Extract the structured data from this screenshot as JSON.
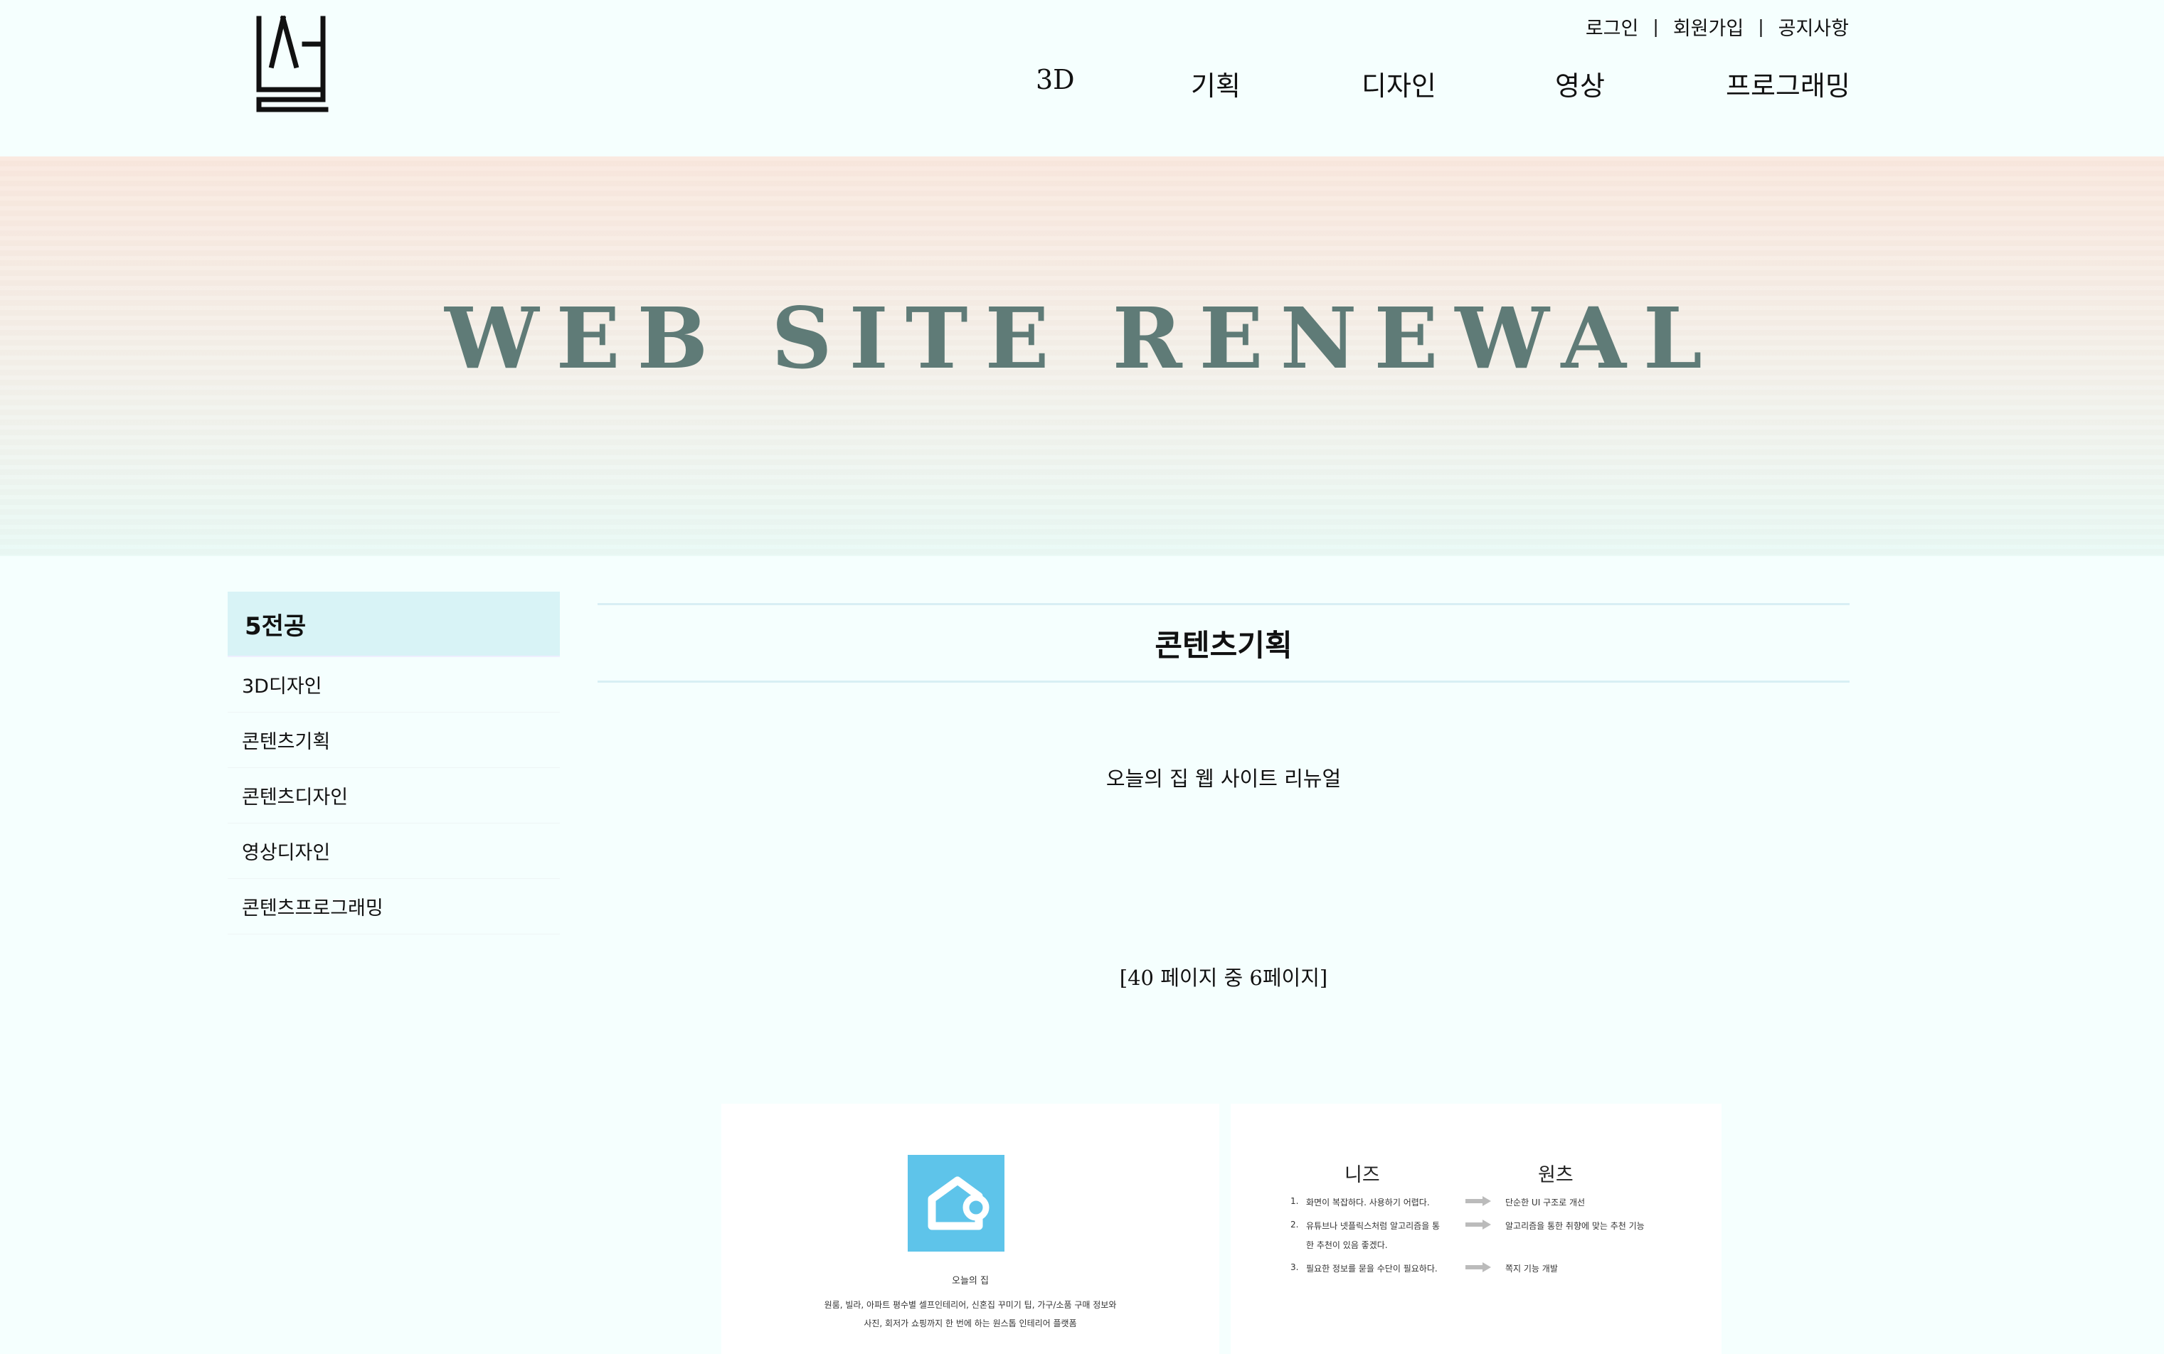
{
  "header": {
    "util_links": [
      "로그인",
      "회원가입",
      "공지사항"
    ],
    "util_separator": "|",
    "nav": [
      "3D",
      "기획",
      "디자인",
      "영상",
      "프로그래밍"
    ]
  },
  "banner": {
    "title": "WEB SITE RENEWAL"
  },
  "sidebar": {
    "heading": "5전공",
    "items": [
      "3D디자인",
      "콘텐츠기획",
      "콘텐츠디자인",
      "영상디자인",
      "콘텐츠프로그래밍"
    ]
  },
  "main": {
    "title": "콘텐츠기획",
    "subtitle": "오늘의 집 웹 사이트 리뉴얼",
    "page_info": "[40 페이지 중 6페이지]"
  },
  "slide1": {
    "app_name": "오늘의 집",
    "desc_line1": "원룸, 빌라, 아파트 평수별 셀프인테리어, 신혼집 꾸미기 팁, 가구/소품 구매 정보와",
    "desc_line2": "사진, 회저가 쇼핑까지 한 번에 하는 원스톱 인테리어 플랫폼"
  },
  "slide2": {
    "col_needs": "니즈",
    "col_wants": "원츠",
    "rows": [
      {
        "num": "1.",
        "need": "화면이 복잡하다. 사용하기 어렵다.",
        "want": "단순한 UI 구조로 개선"
      },
      {
        "num": "2.",
        "need": "유튜브나 넷플릭스처럼 알고리즘을 통",
        "need2": "한 추천이 있음 좋겠다.",
        "want": "알고리즘을 통한 취향에 맞는 추천 기능"
      },
      {
        "num": "3.",
        "need": "필요한 정보를 묻을 수단이 필요하다.",
        "want": "쪽지 기능 개발"
      }
    ]
  },
  "colors": {
    "background": "#f5fffe",
    "banner_title": "#5f7b77",
    "sidebar_active": "#d8f3f6",
    "app_icon": "#5ec4ea"
  }
}
